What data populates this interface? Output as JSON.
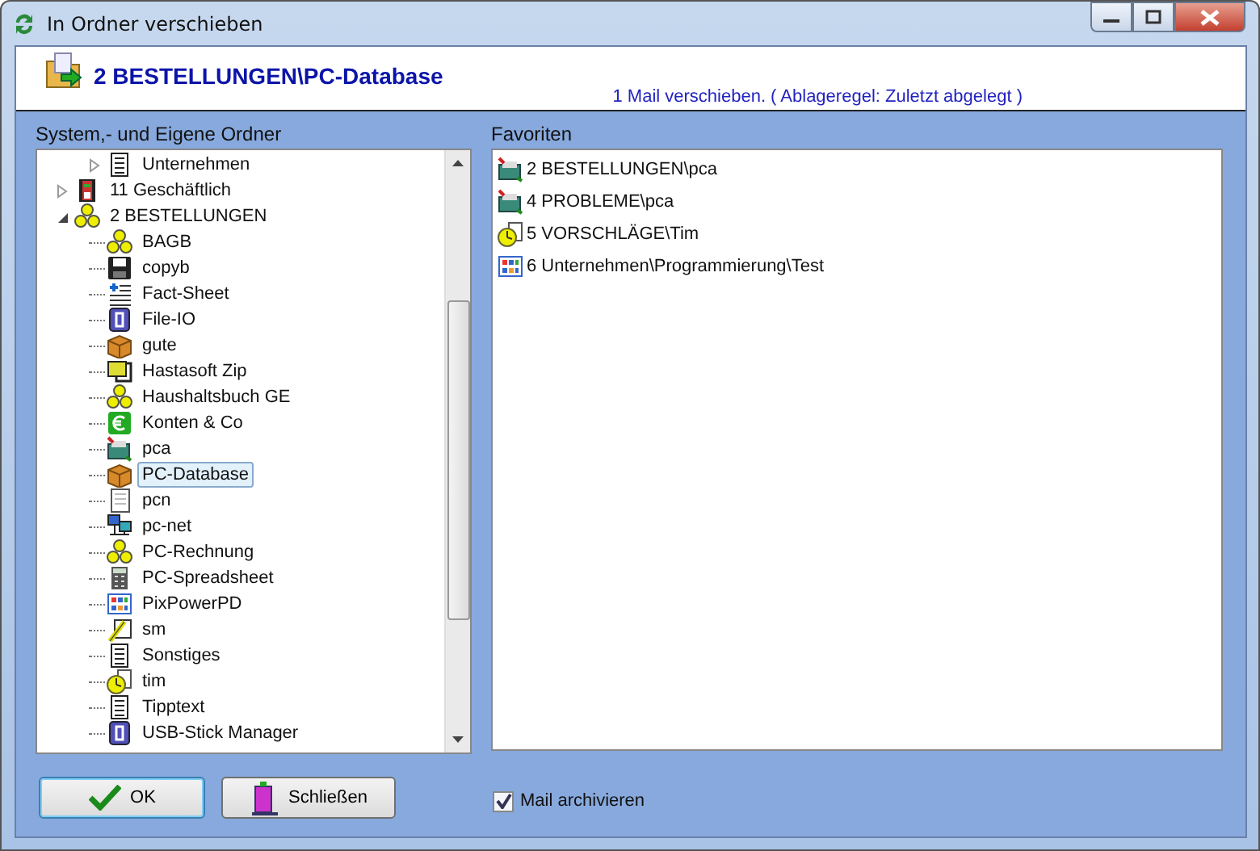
{
  "window": {
    "title": "In Ordner verschieben"
  },
  "header": {
    "title": "2 BESTELLUNGEN\\PC-Database",
    "subtitle": "1 Mail verschieben. ( Ablageregel: Zuletzt abgelegt )"
  },
  "tree": {
    "label": "System,- und Eigene Ordner",
    "items": [
      {
        "children": [
          {
            "label": "Unternehmen",
            "kind": "doc",
            "expanded": false,
            "selected": false
          }
        ]
      },
      {
        "label": "11 Geschäftlich",
        "kind": "binder",
        "expanded": false,
        "selected": false
      },
      {
        "label": "2 BESTELLUNGEN",
        "kind": "coins",
        "expanded": true,
        "selected": false,
        "children": [
          {
            "label": "BAGB",
            "kind": "coins",
            "selected": false
          },
          {
            "label": "copyb",
            "kind": "floppy",
            "selected": false
          },
          {
            "label": "Fact-Sheet",
            "kind": "list",
            "selected": false
          },
          {
            "label": "File-IO",
            "kind": "app",
            "selected": false
          },
          {
            "label": "gute",
            "kind": "box",
            "selected": false
          },
          {
            "label": "Hastasoft Zip",
            "kind": "zip",
            "selected": false
          },
          {
            "label": "Haushaltsbuch GE",
            "kind": "coins",
            "selected": false
          },
          {
            "label": "Konten & Co",
            "kind": "euro",
            "selected": false
          },
          {
            "label": "pca",
            "kind": "tray",
            "selected": false
          },
          {
            "label": "PC-Database",
            "kind": "box",
            "selected": true
          },
          {
            "label": "pcn",
            "kind": "page",
            "selected": false
          },
          {
            "label": "pc-net",
            "kind": "network",
            "selected": false
          },
          {
            "label": "PC-Rechnung",
            "kind": "coins",
            "selected": false
          },
          {
            "label": "PC-Spreadsheet",
            "kind": "calc",
            "selected": false
          },
          {
            "label": "PixPowerPD",
            "kind": "grid",
            "selected": false
          },
          {
            "label": "sm",
            "kind": "pen",
            "selected": false
          },
          {
            "label": "Sonstiges",
            "kind": "doc",
            "selected": false
          },
          {
            "label": "tim",
            "kind": "clock",
            "selected": false
          },
          {
            "label": "Tipptext",
            "kind": "doc",
            "selected": false
          },
          {
            "label": "USB-Stick Manager",
            "kind": "app",
            "selected": false
          }
        ]
      }
    ]
  },
  "favorites": {
    "label": "Favoriten",
    "items": [
      {
        "label": "2 BESTELLUNGEN\\pca",
        "kind": "tray"
      },
      {
        "label": "4 PROBLEME\\pca",
        "kind": "tray"
      },
      {
        "label": "5 VORSCHLÄGE\\Tim",
        "kind": "clock"
      },
      {
        "label": "6 Unternehmen\\Programmierung\\Test",
        "kind": "grid"
      }
    ]
  },
  "buttons": [
    {
      "label": "OK",
      "kind": "ok"
    },
    {
      "label": "Schließen",
      "kind": "close"
    }
  ],
  "archive": {
    "label": "Mail archivieren",
    "checked": true
  }
}
